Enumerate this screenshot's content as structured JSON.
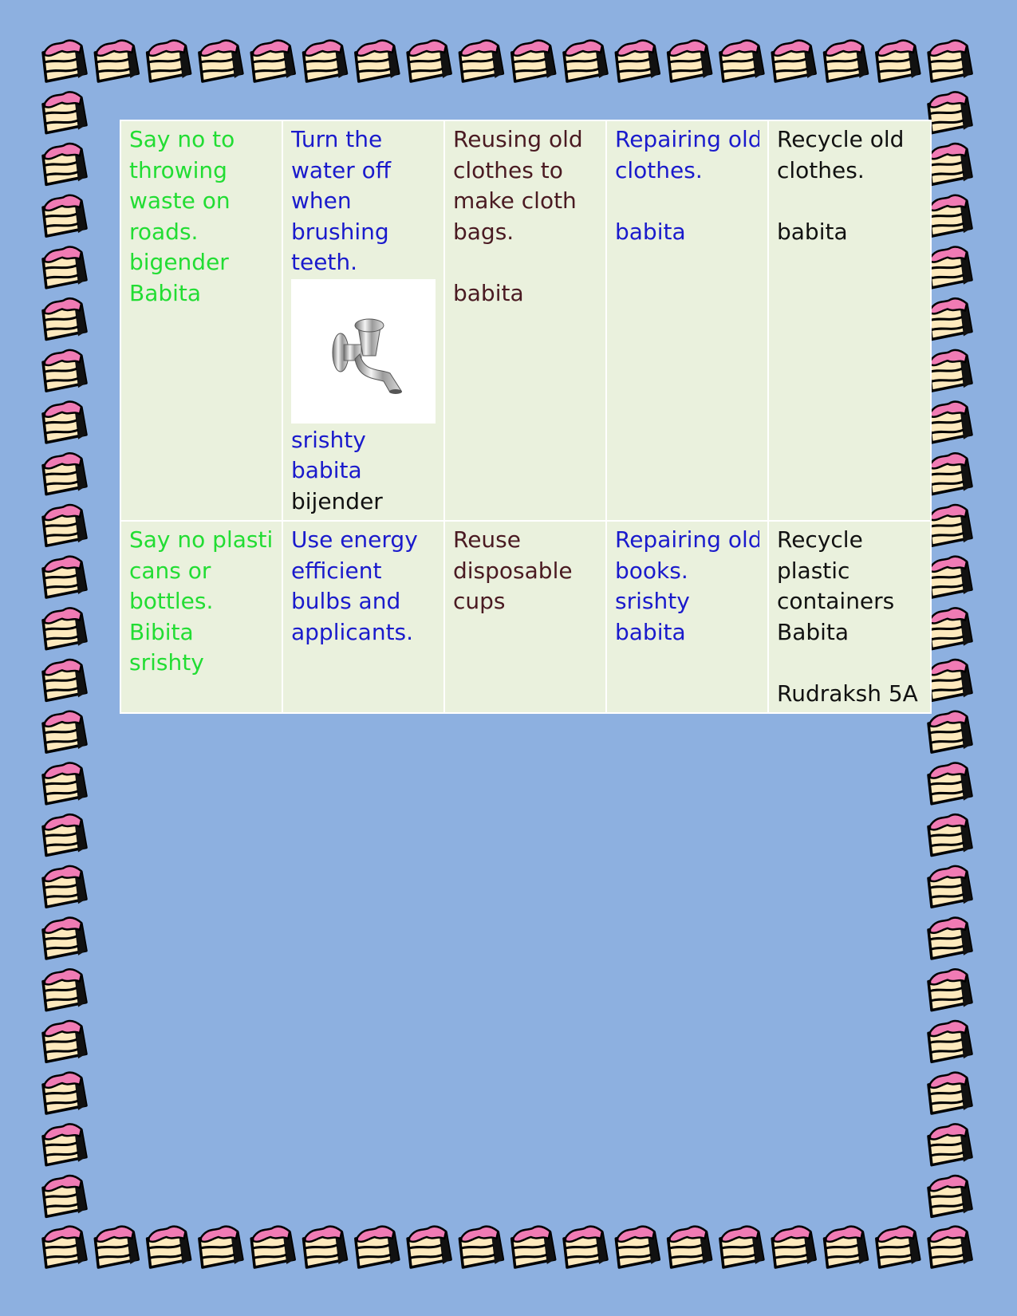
{
  "colors": {
    "page_background": "#8db0e0",
    "table_fill": "#eaf1dd",
    "green_text": "#22dd33",
    "blue_text": "#1a1acc",
    "maroon_text": "#4a1a22",
    "black_text": "#111111"
  },
  "border_icon": "cake-slice-icon",
  "table": {
    "rows": [
      [
        {
          "color": "green",
          "lines": [
            "Say no to",
            "throwing",
            "waste on",
            "roads.",
            "bigender",
            "Babita"
          ]
        },
        {
          "color": "blue",
          "lines": [
            "Turn the",
            "water off",
            "when",
            "brushing",
            "teeth."
          ],
          "image": "water-tap-icon",
          "after_image": [
            {
              "text": "srishty",
              "color": "blue"
            },
            {
              "text": "babita",
              "color": "blue"
            },
            {
              "text": "bijender",
              "color": "black"
            }
          ]
        },
        {
          "color": "maroon",
          "lines": [
            "Reusing old",
            "clothes to",
            "make cloth",
            "bags.",
            "",
            "babita"
          ]
        },
        {
          "color": "blue",
          "lines": [
            "Repairing old",
            "clothes.",
            "",
            "babita"
          ]
        },
        {
          "color": "black",
          "lines": [
            "Recycle old",
            "clothes.",
            "",
            "babita"
          ]
        }
      ],
      [
        {
          "color": "green",
          "lines": [
            "Say no plastic",
            "cans or",
            "bottles.",
            "Bibita",
            "srishty"
          ]
        },
        {
          "color": "blue",
          "lines": [
            "Use energy",
            "efficient",
            "bulbs and",
            "applicants."
          ]
        },
        {
          "color": "maroon",
          "lines": [
            "Reuse",
            "disposable",
            "cups"
          ]
        },
        {
          "color": "blue",
          "lines": [
            "Repairing old",
            "books.",
            "srishty",
            "babita"
          ]
        },
        {
          "color": "black",
          "lines": [
            "Recycle",
            "plastic",
            "containers",
            "Babita",
            "",
            "Rudraksh 5A"
          ]
        }
      ]
    ]
  }
}
